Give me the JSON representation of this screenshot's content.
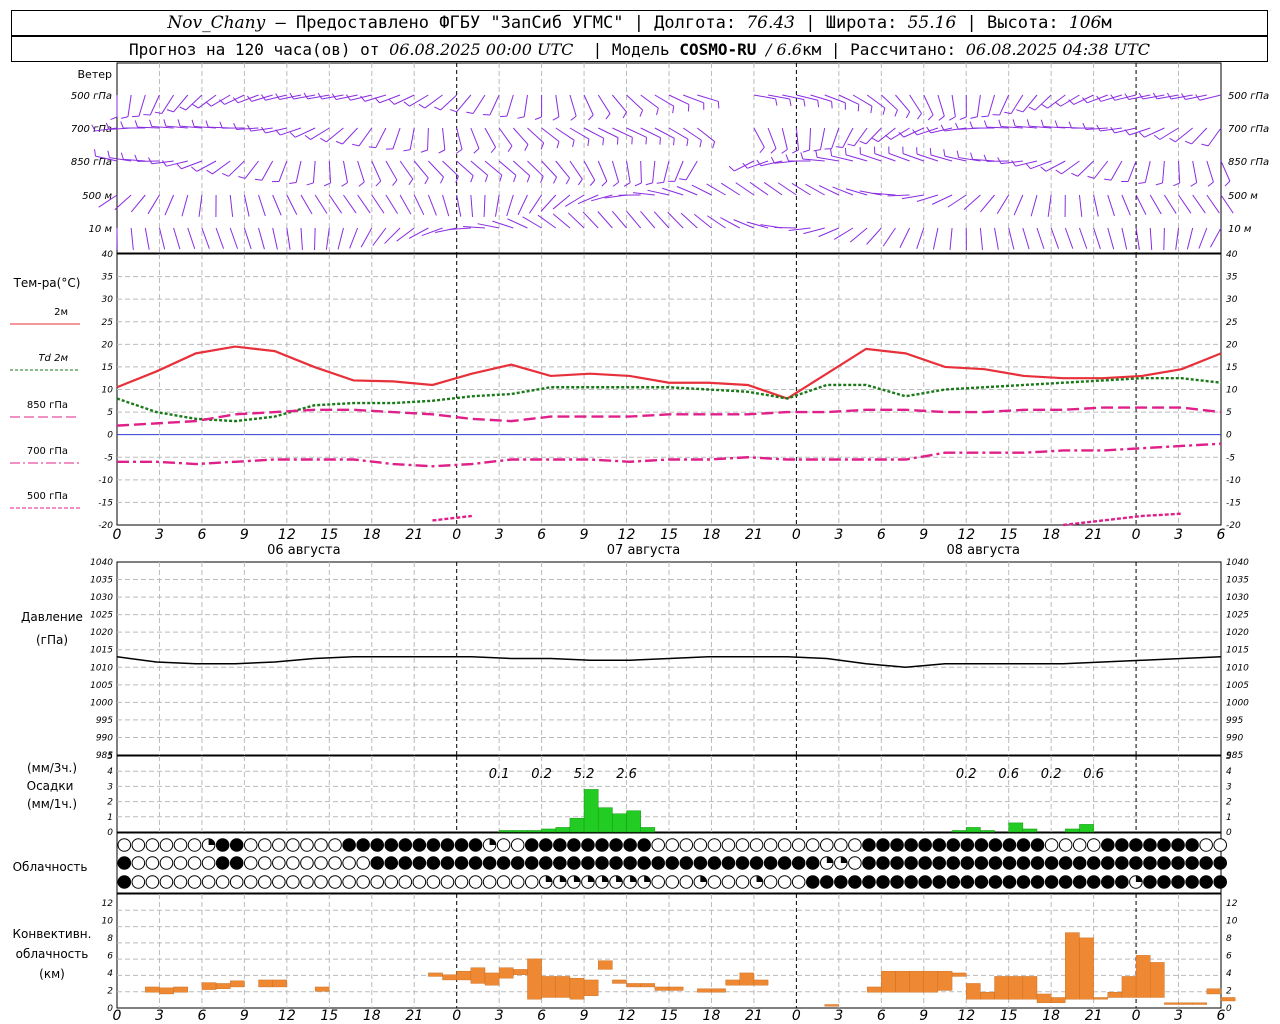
{
  "header": {
    "station": "Nov_Chany",
    "provided_by": "– Предоставлено ФГБУ \"ЗапСиб УГМС\" | Долгота:",
    "longitude": "76.43",
    "lat_label": "| Широта:",
    "latitude": "55.16",
    "alt_label": "| Высота:",
    "altitude": "106",
    "alt_unit": "м",
    "forecast_label": "Прогноз на 120 часа(ов) от",
    "forecast_start": "06.08.2025 00:00 UTC",
    "model_label": "| Модель",
    "model": "COSMO-RU",
    "resolution": "/ 6.6",
    "res_unit": "км",
    "calc_label": "| Рассчитано:",
    "calculated": "06.08.2025 04:38 UTC"
  },
  "colors": {
    "t2m": "#e8303a",
    "td2m": "#1a7a1a",
    "t850": "#e0208a",
    "t700": "#e0208a",
    "t500": "#e0208a",
    "zero_line": "#2a3ad8",
    "wind": "#8a2be2",
    "precip": "#22cc22",
    "conv": "#ee8833",
    "pressure": "#000000"
  },
  "chart_data": [
    {
      "type": "wind-barbs",
      "title": "Ветер",
      "levels": [
        "500 гПа",
        "700 гПа",
        "850 гПа",
        "500 м",
        "10 м"
      ]
    },
    {
      "type": "line",
      "title": "Тем-ра(°С)",
      "legend": [
        "2м",
        "Td 2м",
        "850 гПа",
        "700 гПа",
        "500 гПа"
      ],
      "x_ticks": [
        "0",
        "3",
        "6",
        "9",
        "12",
        "15",
        "18",
        "21",
        "0",
        "3",
        "6",
        "9",
        "12",
        "15",
        "18",
        "21",
        "0",
        "3",
        "6",
        "9",
        "12",
        "15",
        "18",
        "21",
        "0",
        "3",
        "6"
      ],
      "day_labels": [
        "06 августа",
        "07 августа",
        "08 августа"
      ],
      "ylim": [
        -20,
        40
      ],
      "y_ticks": [
        "40",
        "35",
        "30",
        "25",
        "20",
        "15",
        "10",
        "5",
        "0",
        "-5",
        "-10",
        "-15",
        "-20"
      ],
      "x_hours": [
        0,
        3,
        6,
        9,
        12,
        15,
        18,
        21,
        24,
        27,
        30,
        33,
        36,
        39,
        42,
        45,
        48,
        51,
        54,
        57,
        60,
        63,
        66,
        69,
        72,
        75,
        78
      ],
      "series": [
        {
          "name": "2м",
          "values": [
            10.5,
            14,
            18,
            19.5,
            18.5,
            15,
            12,
            11.8,
            11,
            13.5,
            15.5,
            13,
            13.5,
            13,
            11.5,
            11.5,
            11,
            8,
            13.5,
            19,
            18,
            15,
            14.5,
            13,
            12.5,
            12.5,
            13,
            14.5,
            18
          ]
        },
        {
          "name": "Td 2м",
          "values": [
            8,
            5,
            3.5,
            3,
            4,
            6.5,
            7,
            7,
            7.5,
            8.5,
            9,
            10.5,
            10.5,
            10.5,
            10.5,
            10,
            9.5,
            8,
            11,
            11,
            8.5,
            10,
            10.5,
            11,
            11.5,
            12,
            12.5,
            12.5,
            11.5
          ]
        },
        {
          "name": "850 гПа",
          "values": [
            2,
            2.5,
            3,
            4.5,
            5,
            5.5,
            5.5,
            5,
            4.5,
            3.5,
            3,
            4,
            4,
            4,
            4.5,
            4.5,
            4.5,
            5,
            5,
            5.5,
            5.5,
            5,
            5,
            5.5,
            5.5,
            6,
            6,
            6,
            5
          ]
        },
        {
          "name": "700 гПа",
          "values": [
            -6,
            -6,
            -6.5,
            -6,
            -5.5,
            -5.5,
            -5.5,
            -6.5,
            -7,
            -6.5,
            -5.5,
            -5.5,
            -5.5,
            -6,
            -5.5,
            -5.5,
            -5,
            -5.5,
            -5.5,
            -5.5,
            -5.5,
            -4,
            -4,
            -4,
            -3.5,
            -3.5,
            -3,
            -2.5,
            -2
          ]
        },
        {
          "name": "500 гПа",
          "values": [
            null,
            null,
            null,
            null,
            null,
            null,
            null,
            null,
            -19,
            -18,
            null,
            null,
            null,
            null,
            null,
            null,
            null,
            null,
            null,
            null,
            null,
            null,
            null,
            null,
            -20,
            -19,
            -18,
            -17.5
          ]
        }
      ]
    },
    {
      "type": "line",
      "title": "Давление",
      "ylabel": "(гПа)",
      "ylim": [
        985,
        1040
      ],
      "y_ticks": [
        "1040",
        "1035",
        "1030",
        "1025",
        "1020",
        "1015",
        "1010",
        "1005",
        "1000",
        "995",
        "990",
        "985"
      ],
      "series": [
        {
          "name": "pressure",
          "values": [
            1013,
            1011.5,
            1011,
            1011,
            1011.5,
            1012.5,
            1013,
            1013,
            1013,
            1013,
            1012.5,
            1012.5,
            1012,
            1012,
            1012.5,
            1013,
            1013,
            1013,
            1012.5,
            1011,
            1010,
            1011,
            1011,
            1011,
            1011,
            1011.5,
            1012,
            1012.5,
            1013
          ]
        }
      ]
    },
    {
      "type": "bar",
      "title": "Осадки",
      "ylabel_top": "(мм/3ч.)",
      "ylabel_bottom": "(мм/1ч.)",
      "ylim": [
        0,
        5
      ],
      "y_ticks": [
        "5",
        "4",
        "3",
        "2",
        "1",
        "0"
      ],
      "labels": [
        {
          "hour": 27,
          "text": "0.1"
        },
        {
          "hour": 30,
          "text": "0.2"
        },
        {
          "hour": 33,
          "text": "5.2"
        },
        {
          "hour": 36,
          "text": "2.6"
        },
        {
          "hour": 60,
          "text": "0.2"
        },
        {
          "hour": 63,
          "text": "0.6"
        },
        {
          "hour": 66,
          "text": "0.2"
        },
        {
          "hour": 69,
          "text": "0.6"
        }
      ],
      "bars": [
        {
          "hour": 27,
          "value": 0.1
        },
        {
          "hour": 28,
          "value": 0.1
        },
        {
          "hour": 29,
          "value": 0.1
        },
        {
          "hour": 30,
          "value": 0.2
        },
        {
          "hour": 31,
          "value": 0.3
        },
        {
          "hour": 32,
          "value": 0.9
        },
        {
          "hour": 33,
          "value": 2.8
        },
        {
          "hour": 34,
          "value": 1.6
        },
        {
          "hour": 35,
          "value": 1.2
        },
        {
          "hour": 36,
          "value": 1.4
        },
        {
          "hour": 37,
          "value": 0.3
        },
        {
          "hour": 59,
          "value": 0.1
        },
        {
          "hour": 60,
          "value": 0.3
        },
        {
          "hour": 61,
          "value": 0.1
        },
        {
          "hour": 63,
          "value": 0.6
        },
        {
          "hour": 64,
          "value": 0.2
        },
        {
          "hour": 67,
          "value": 0.2
        },
        {
          "hour": 68,
          "value": 0.5
        }
      ]
    },
    {
      "type": "cloud-symbols",
      "title": "Облачность",
      "rows": [
        "0000002110000000111111111120011111111100000000000000011111111111110000111111100000000000",
        "1000000110000000001111111111111111111111111111111122011111111111111111111111111111000000",
        "1000000000000000000000000000002222222200020002000111111111111111111111112111111111111111"
      ]
    },
    {
      "type": "bar",
      "title": "Конвективн. облачность",
      "ylabel": "(км)",
      "ylim": [
        0,
        13
      ],
      "y_ticks": [
        "12",
        "10",
        "8",
        "6",
        "4",
        "2",
        "0"
      ],
      "bars": [
        {
          "hour": 3,
          "base": 1.8,
          "top": 2.4
        },
        {
          "hour": 4,
          "base": 1.6,
          "top": 2.3
        },
        {
          "hour": 5,
          "base": 1.8,
          "top": 2.4
        },
        {
          "hour": 7,
          "base": 2.1,
          "top": 2.9
        },
        {
          "hour": 8,
          "base": 2.2,
          "top": 2.8
        },
        {
          "hour": 9,
          "base": 2.4,
          "top": 3.1
        },
        {
          "hour": 11,
          "base": 2.4,
          "top": 3.2
        },
        {
          "hour": 12,
          "base": 2.4,
          "top": 3.2
        },
        {
          "hour": 15,
          "base": 1.9,
          "top": 2.4
        },
        {
          "hour": 23,
          "base": 3.6,
          "top": 4.0
        },
        {
          "hour": 24,
          "base": 3.2,
          "top": 3.8
        },
        {
          "hour": 25,
          "base": 3.2,
          "top": 4.2
        },
        {
          "hour": 26,
          "base": 2.8,
          "top": 4.6
        },
        {
          "hour": 27,
          "base": 2.6,
          "top": 4.0
        },
        {
          "hour": 28,
          "base": 3.4,
          "top": 4.6
        },
        {
          "hour": 29,
          "base": 3.8,
          "top": 4.4
        },
        {
          "hour": 30,
          "base": 1.0,
          "top": 5.6
        },
        {
          "hour": 31,
          "base": 1.2,
          "top": 3.6
        },
        {
          "hour": 32,
          "base": 1.2,
          "top": 3.6
        },
        {
          "hour": 33,
          "base": 1.0,
          "top": 3.4
        },
        {
          "hour": 34,
          "base": 1.4,
          "top": 3.2
        },
        {
          "hour": 35,
          "base": 4.4,
          "top": 5.4
        },
        {
          "hour": 36,
          "base": 2.8,
          "top": 3.2
        },
        {
          "hour": 37,
          "base": 2.4,
          "top": 2.8
        },
        {
          "hour": 38,
          "base": 2.4,
          "top": 2.8
        },
        {
          "hour": 39,
          "base": 2.0,
          "top": 2.4
        },
        {
          "hour": 40,
          "base": 2.0,
          "top": 2.4
        },
        {
          "hour": 42,
          "base": 1.8,
          "top": 2.2
        },
        {
          "hour": 43,
          "base": 1.8,
          "top": 2.2
        },
        {
          "hour": 44,
          "base": 2.6,
          "top": 3.2
        },
        {
          "hour": 45,
          "base": 2.6,
          "top": 4.0
        },
        {
          "hour": 46,
          "base": 2.6,
          "top": 3.2
        },
        {
          "hour": 51,
          "base": 0.2,
          "top": 0.4
        },
        {
          "hour": 54,
          "base": 1.8,
          "top": 2.4
        },
        {
          "hour": 55,
          "base": 1.8,
          "top": 4.2
        },
        {
          "hour": 56,
          "base": 1.8,
          "top": 4.2
        },
        {
          "hour": 57,
          "base": 1.8,
          "top": 4.2
        },
        {
          "hour": 58,
          "base": 1.8,
          "top": 4.2
        },
        {
          "hour": 59,
          "base": 2.0,
          "top": 4.2
        },
        {
          "hour": 60,
          "base": 3.6,
          "top": 4.0
        },
        {
          "hour": 61,
          "base": 1.0,
          "top": 2.8
        },
        {
          "hour": 62,
          "base": 1.0,
          "top": 1.8
        },
        {
          "hour": 63,
          "base": 1.0,
          "top": 3.6
        },
        {
          "hour": 64,
          "base": 1.0,
          "top": 3.6
        },
        {
          "hour": 65,
          "base": 1.0,
          "top": 3.6
        },
        {
          "hour": 66,
          "base": 0.6,
          "top": 1.6
        },
        {
          "hour": 67,
          "base": 0.6,
          "top": 1.2
        },
        {
          "hour": 68,
          "base": 1.0,
          "top": 8.6
        },
        {
          "hour": 69,
          "base": 1.0,
          "top": 8.0
        },
        {
          "hour": 70,
          "base": 1.0,
          "top": 1.2
        },
        {
          "hour": 71,
          "base": 1.2,
          "top": 1.8
        },
        {
          "hour": 72,
          "base": 1.2,
          "top": 3.6
        },
        {
          "hour": 73,
          "base": 1.2,
          "top": 6.0
        },
        {
          "hour": 74,
          "base": 1.2,
          "top": 5.2
        },
        {
          "hour": 75,
          "base": 0.4,
          "top": 0.6
        },
        {
          "hour": 76,
          "base": 0.4,
          "top": 0.6
        },
        {
          "hour": 77,
          "base": 0.4,
          "top": 0.6
        },
        {
          "hour": 78,
          "base": 1.6,
          "top": 2.2
        },
        {
          "hour": 79,
          "base": 0.8,
          "top": 1.2
        }
      ]
    }
  ]
}
